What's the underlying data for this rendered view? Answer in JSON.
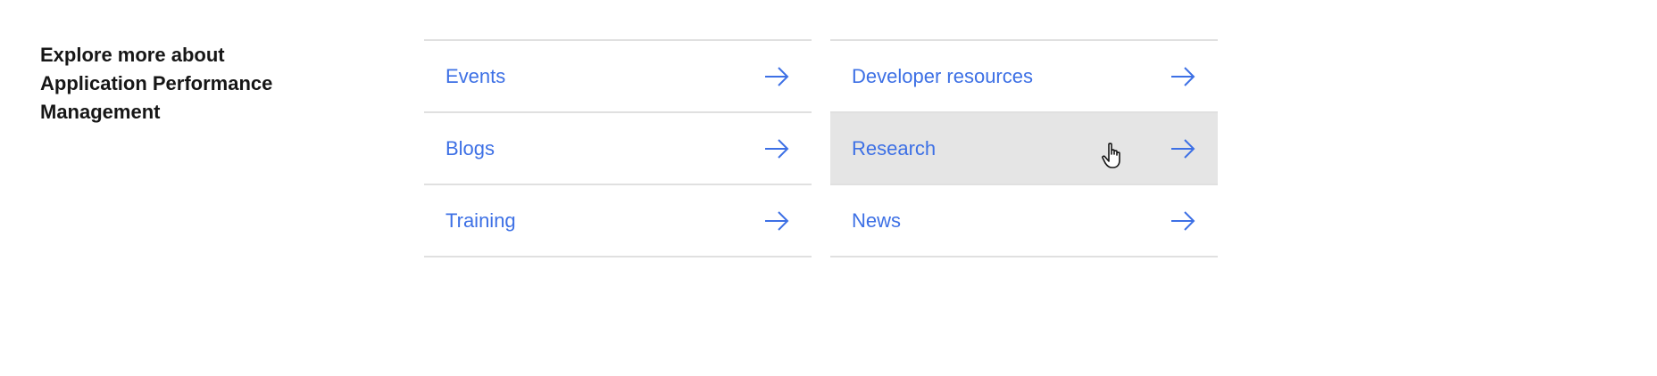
{
  "section": {
    "heading": "Explore more about Application Performance Management"
  },
  "links": {
    "left": [
      {
        "label": "Events"
      },
      {
        "label": "Blogs"
      },
      {
        "label": "Training"
      }
    ],
    "right": [
      {
        "label": "Developer resources"
      },
      {
        "label": "Research"
      },
      {
        "label": "News"
      }
    ]
  },
  "icons": {
    "arrow": "arrow-right-icon",
    "cursor": "hand-pointer-icon"
  },
  "colors": {
    "link": "#3d70e5",
    "divider": "#e0e0e0",
    "hover_bg": "#e5e5e5",
    "heading": "#161616"
  },
  "state": {
    "hovered_item": "Research"
  }
}
